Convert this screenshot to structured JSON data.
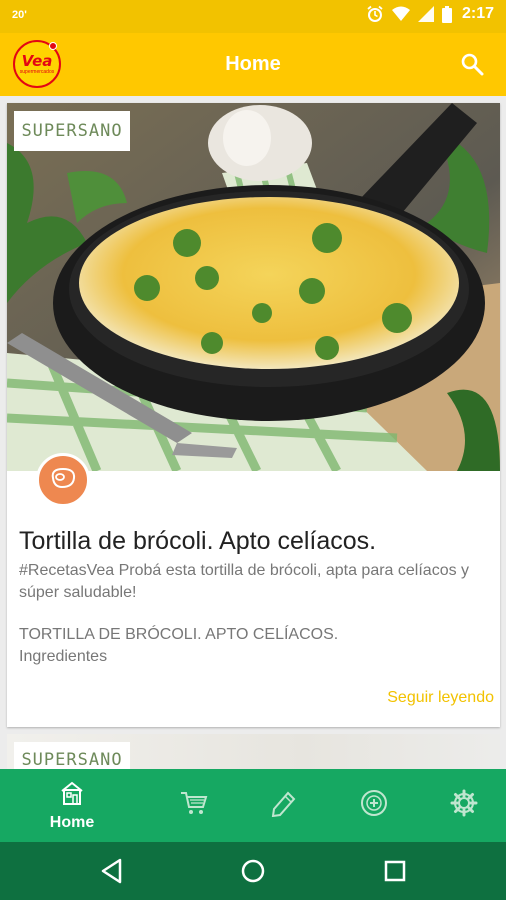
{
  "status_bar": {
    "left_text": "20'",
    "time": "2:17"
  },
  "app_bar": {
    "logo_text": "Vea",
    "logo_subtext": "supermercados",
    "title": "Home",
    "search_icon": "search-icon"
  },
  "feed": {
    "cards": [
      {
        "brand_tag": "SUPERSANO",
        "image": "broccoli-tortilla-in-cast-iron-pan",
        "category_icon": "meat-icon",
        "title": "Tortilla de brócoli. Apto celíacos.",
        "description": "#RecetasVea Probá esta tortilla de brócoli, apta para celíacos y súper saludable!",
        "excerpt_line1": "TORTILLA DE BRÓCOLI. APTO CELÍACOS.",
        "excerpt_line2": "Ingredientes",
        "read_more": "Seguir leyendo"
      },
      {
        "brand_tag": "SUPERSANO"
      }
    ]
  },
  "bottom_nav": {
    "items": [
      {
        "icon": "home-icon",
        "label": "Home",
        "active": true
      },
      {
        "icon": "cart-icon",
        "label": ""
      },
      {
        "icon": "pencil-icon",
        "label": ""
      },
      {
        "icon": "add-circle-icon",
        "label": ""
      },
      {
        "icon": "gear-icon",
        "label": ""
      }
    ]
  },
  "system_nav": {
    "back": "back-icon",
    "home": "home-circle-icon",
    "recents": "recents-icon"
  },
  "colors": {
    "app_bar": "#ffc800",
    "status_bar": "#f2c200",
    "bottom_nav": "#16a862",
    "system_nav": "#0e7040",
    "accent": "#f2c200",
    "category_badge": "#ee8850"
  }
}
